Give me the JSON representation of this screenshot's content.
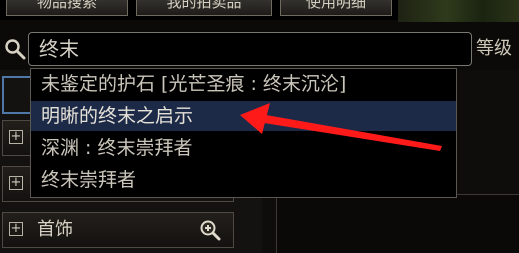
{
  "tabs": [
    {
      "label": "物品搜索"
    },
    {
      "label": "我的拍卖品"
    },
    {
      "label": "使用明细"
    }
  ],
  "search": {
    "value": "终末",
    "level_label": "等级"
  },
  "dropdown": {
    "items": [
      {
        "label": "未鉴定的护石 [光芒圣痕 : 终末沉沦]"
      },
      {
        "label": "明晰的终末之启示",
        "selected": true
      },
      {
        "label": "深渊 : 终末崇拜者"
      },
      {
        "label": "终末崇拜者"
      }
    ]
  },
  "categories": [
    {
      "label": "首饰"
    }
  ],
  "colors": {
    "selection_bg": "#1c2a48",
    "arrow": "#ff1a1a",
    "accent_blue": "#4f78a8"
  }
}
